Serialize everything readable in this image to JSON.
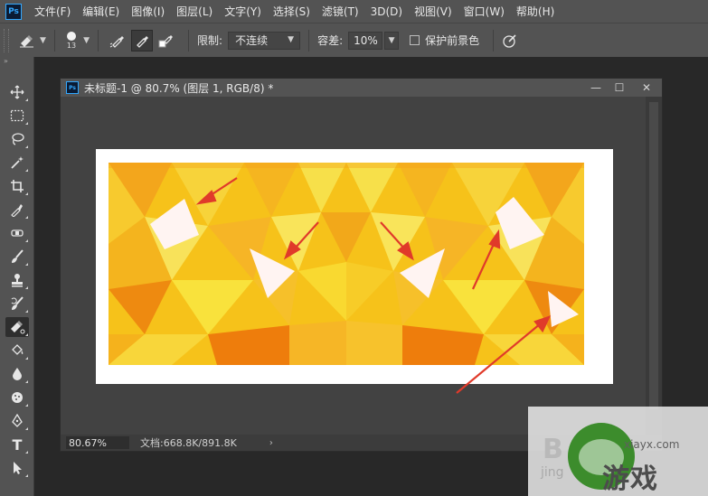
{
  "app": {
    "logo_text": "Ps"
  },
  "menu": [
    "文件(F)",
    "编辑(E)",
    "图像(I)",
    "图层(L)",
    "文字(Y)",
    "选择(S)",
    "滤镜(T)",
    "3D(D)",
    "视图(V)",
    "窗口(W)",
    "帮助(H)"
  ],
  "options": {
    "brush_size": "13",
    "limit_label": "限制:",
    "limit_value": "不连续",
    "tolerance_label": "容差:",
    "tolerance_value": "10%",
    "protect_fg_label": "保护前景色",
    "protect_fg_checked": false
  },
  "tools": [
    "move-tool",
    "marquee-tool",
    "lasso-tool",
    "magic-wand-tool",
    "crop-tool",
    "eyedropper-tool",
    "healing-brush-tool",
    "brush-tool",
    "clone-stamp-tool",
    "history-brush-tool",
    "background-eraser-tool",
    "paint-bucket-tool",
    "blur-tool",
    "dodge-tool",
    "pen-tool",
    "type-tool",
    "path-selection-tool"
  ],
  "active_tool": "background-eraser-tool",
  "document": {
    "tab_icon": "Ps",
    "title": "未标题-1 @ 80.7% (图层 1, RGB/8) *",
    "zoom": "80.67%",
    "doc_info": "文档:668.8K/891.8K",
    "status_arrow": "›"
  },
  "colors": {
    "ui_background": "#282828",
    "panel": "#535353",
    "art_yellow_light": "#f5df3a",
    "art_yellow": "#f6c21a",
    "art_orange": "#f08a0c",
    "annotation_red": "#e03a2a"
  },
  "watermark": {
    "left_letters": "B",
    "url": "xiayx.com",
    "brand": "游戏",
    "sub": "jing"
  }
}
